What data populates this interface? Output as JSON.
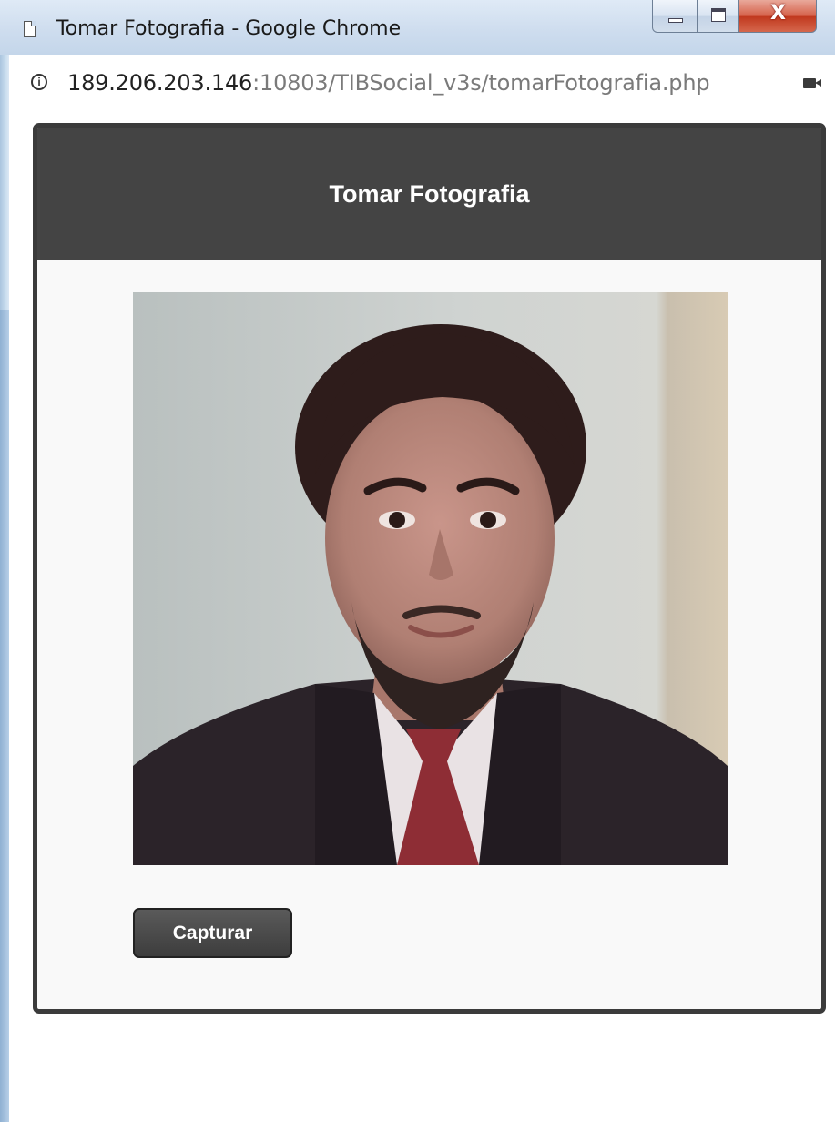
{
  "window": {
    "title": "Tomar Fotografia - Google Chrome",
    "close_glyph": "X"
  },
  "address_bar": {
    "host": "189.206.203.146",
    "path": ":10803/TIBSocial_v3s/tomarFotografia.php"
  },
  "page": {
    "title": "Tomar Fotografia",
    "capture_label": "Capturar"
  },
  "icons": {
    "document": "document-icon",
    "info": "info-icon",
    "camera": "camera-icon"
  },
  "colors": {
    "header_bg": "#444444",
    "dialog_border": "#3b3b3b",
    "button_bg": "#3d3d3d"
  }
}
